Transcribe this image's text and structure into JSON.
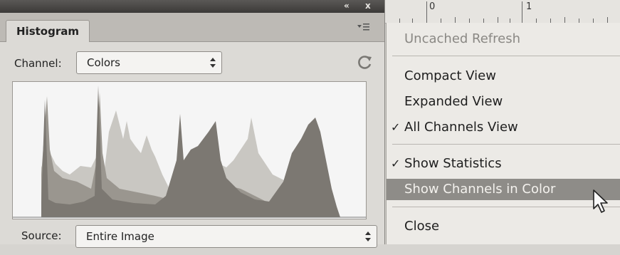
{
  "panel": {
    "title_controls": [
      "«",
      "x"
    ],
    "tab": "Histogram",
    "menu_icon": "panel-menu-icon",
    "channel": {
      "label": "Channel:",
      "value": "Colors"
    },
    "refresh_icon": "refresh-icon",
    "source": {
      "label": "Source:",
      "value": "Entire Image"
    },
    "histogram_colors": {
      "background": "#f5f5f5",
      "dark": "#7c7872",
      "mid": "#9a968f",
      "light": "#c9c7c2"
    }
  },
  "ruler": {
    "labels": [
      "0",
      "1"
    ]
  },
  "menu": {
    "items": [
      {
        "label": "Uncached Refresh",
        "disabled": true,
        "checked": false
      },
      {
        "label": "Compact View",
        "checked": false
      },
      {
        "label": "Expanded View",
        "checked": false
      },
      {
        "label": "All Channels View",
        "checked": true
      },
      {
        "label": "Show Statistics",
        "checked": true
      },
      {
        "label": "Show Channels in Color",
        "checked": false,
        "highlighted": true
      },
      {
        "label": "Close",
        "checked": false
      }
    ],
    "check_glyph": "✓"
  }
}
